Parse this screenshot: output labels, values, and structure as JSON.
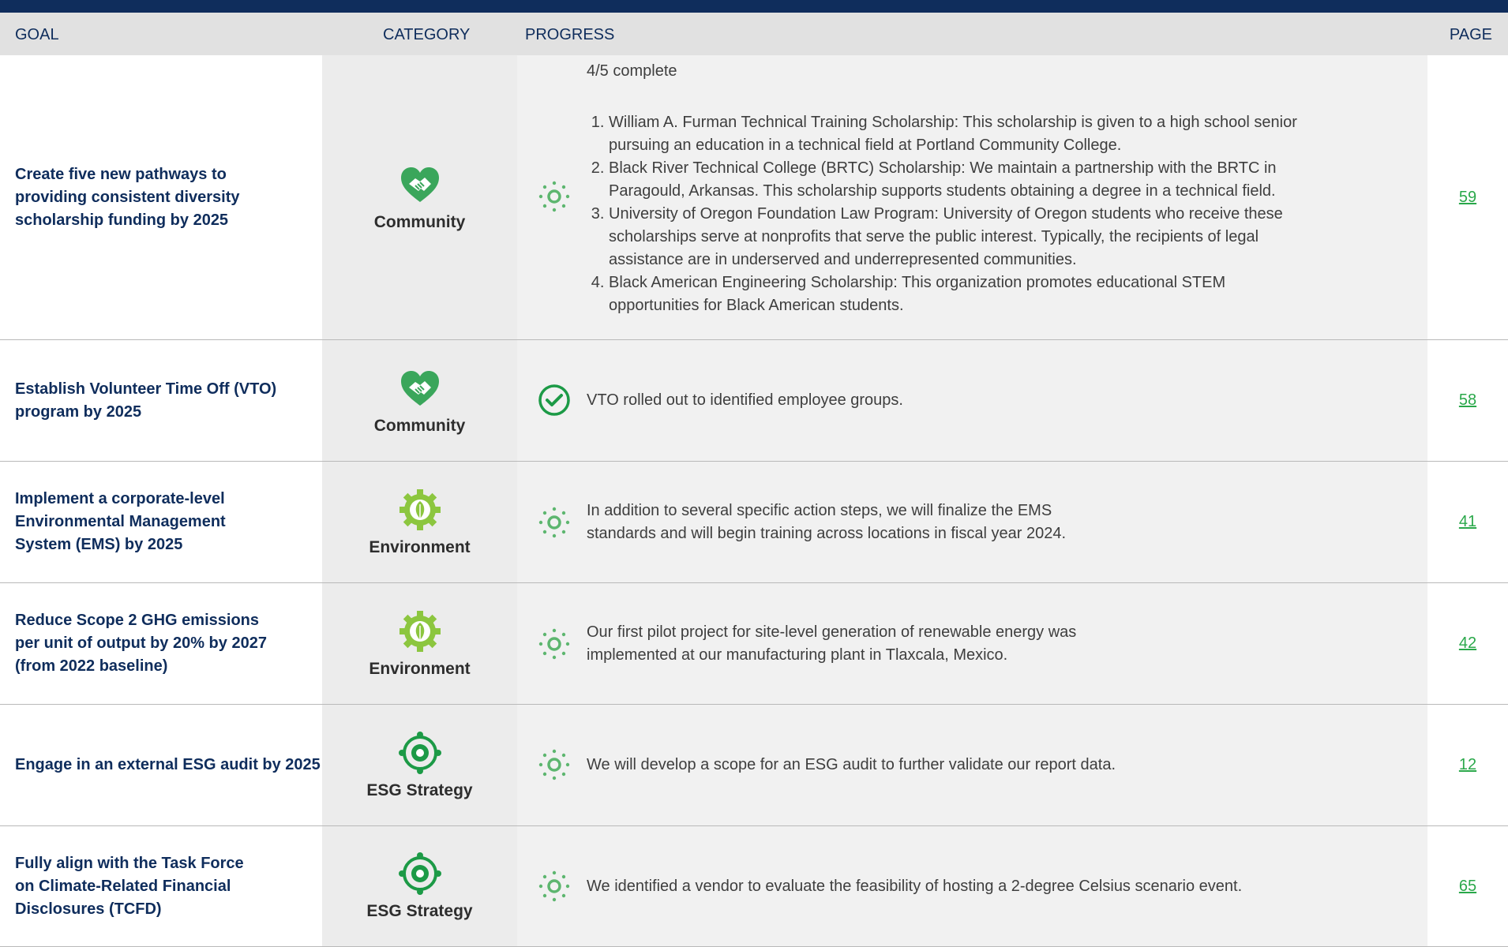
{
  "header": {
    "goal": "GOAL",
    "category": "CATEGORY",
    "progress": "PROGRESS",
    "page": "PAGE"
  },
  "rows": [
    {
      "goal": "Create five new pathways to providing consistent diversity scholarship funding by 2025",
      "category": "Community",
      "category_icon": "handshake-heart-icon",
      "status": "in-progress",
      "status_icon": "in-progress-icon",
      "progress_intro": "4/5 complete",
      "progress_items": [
        "William A. Furman Technical Training Scholarship: This scholarship is given to a high school senior pursuing an education in a technical field at Portland Community College.",
        "Black River Technical College (BRTC) Scholarship: We maintain a partnership with the BRTC in Paragould, Arkansas. This scholarship supports students obtaining a degree in a technical field.",
        "University of Oregon Foundation Law Program: University of Oregon students who receive these scholarships serve at nonprofits that serve the public interest. Typically, the recipients of legal assistance are in underserved and underrepresented communities.",
        "Black American Engineering Scholarship: This organization promotes educational STEM opportunities for Black American students."
      ],
      "page": "59"
    },
    {
      "goal": "Establish Volunteer Time Off (VTO) program by 2025",
      "category": "Community",
      "category_icon": "handshake-heart-icon",
      "status": "complete",
      "status_icon": "check-circle-icon",
      "progress": "VTO rolled out to identified employee groups.",
      "page": "58"
    },
    {
      "goal": "Implement a corporate-level Environmental Management System (EMS) by 2025",
      "category": "Environment",
      "category_icon": "leaf-gear-icon",
      "status": "in-progress",
      "status_icon": "in-progress-icon",
      "progress": "In addition to several specific action steps, we will finalize the EMS standards and will begin training across locations in fiscal year 2024.",
      "page": "41"
    },
    {
      "goal": "Reduce Scope 2 GHG emissions per unit of output by 20% by 2027 (from 2022 baseline)",
      "category": "Environment",
      "category_icon": "leaf-gear-icon",
      "status": "in-progress",
      "status_icon": "in-progress-icon",
      "progress": "Our first pilot project for site-level generation of renewable energy was implemented at our manufacturing plant in Tlaxcala, Mexico.",
      "page": "42"
    },
    {
      "goal": "Engage in an external ESG audit by 2025",
      "category": "ESG Strategy",
      "category_icon": "target-network-icon",
      "status": "in-progress",
      "status_icon": "in-progress-icon",
      "progress": "We will develop a scope for an ESG audit to further validate our report data.",
      "page": "12"
    },
    {
      "goal": "Fully align with the Task Force on Climate-Related Financial Disclosures (TCFD)",
      "category": "ESG Strategy",
      "category_icon": "target-network-icon",
      "status": "in-progress",
      "status_icon": "in-progress-icon",
      "progress": "We identified a vendor to evaluate the feasibility of hosting a 2-degree Celsius scenario event.",
      "page": "65"
    }
  ],
  "colors": {
    "navy": "#0f2d5c",
    "green": "#2aa84a",
    "community_green": "#3aa65b",
    "environment_green": "#8cc63f",
    "esg_green": "#1c9a46",
    "progress_green": "#5db66f"
  }
}
